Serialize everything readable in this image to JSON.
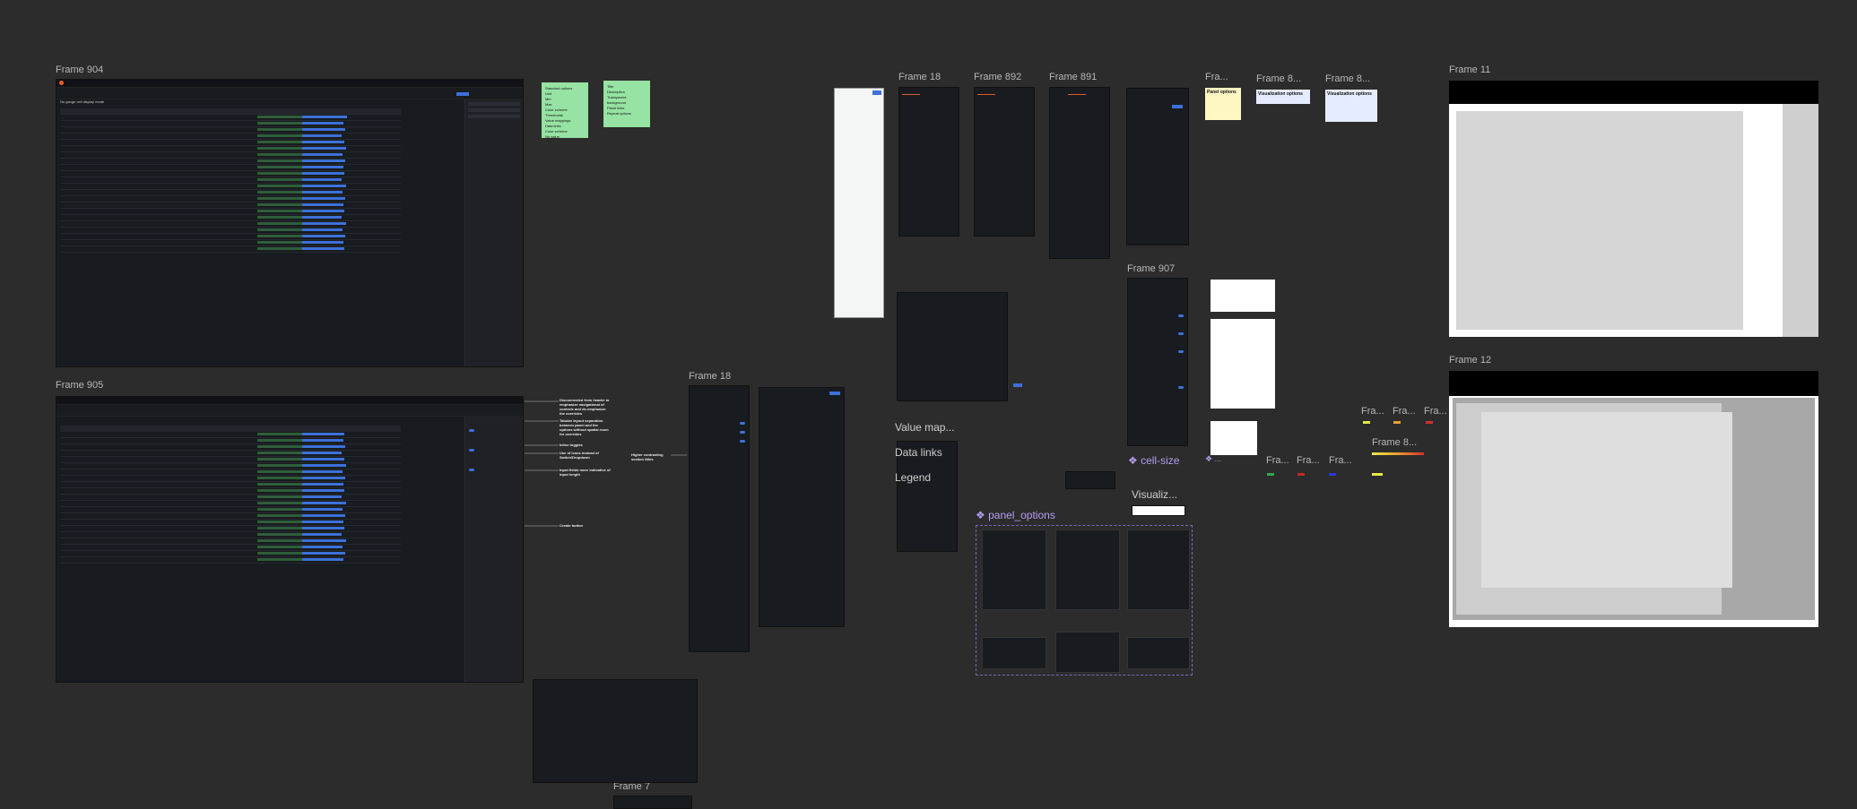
{
  "frames": {
    "f904": "Frame 904",
    "f905": "Frame 905",
    "f18a": "Frame 18",
    "f892": "Frame 892",
    "f891": "Frame 891",
    "fra1": "Fra...",
    "f8a": "Frame 8...",
    "f8b": "Frame 8...",
    "f11": "Frame 11",
    "f907": "Frame 907",
    "f12": "Frame 12",
    "f18b": "Frame 18",
    "f7": "Frame 7",
    "fra2": "Fra...",
    "fra3": "Fra...",
    "fra4": "Fra...",
    "fra5": "Fra...",
    "fra6": "Fra...",
    "f8c": "Frame 8..."
  },
  "components": {
    "value_map": "Value map...",
    "data_links": "Data links",
    "legend": "Legend",
    "panel_options": "panel_options",
    "cell_size": "cell-size",
    "visualiz": "Visualiz...",
    "dots": "..."
  },
  "notes": {
    "panel_options": "Panel options",
    "viz_options_a": "Visualization options",
    "viz_options_b": "Visualization options",
    "sticky_a": [
      "Standard options",
      "Unit",
      "Min",
      "Max",
      "Color scheme",
      "Thresholds",
      "Value mappings",
      "Data links",
      "Color scheme",
      "No value"
    ],
    "sticky_b": [
      "Title",
      "Description",
      "Transparent",
      "background",
      "Panel links",
      "Repeat options"
    ]
  },
  "annotations": [
    "Disconnected from header to emphasize navigational of controls and de-emphasize the overrides",
    "Tabular layout separation between panel and the options without spatial room for overrides",
    "Inline toggles",
    "Use of icons instead of Switch/Dropdown",
    "Input fields more indicative of input length",
    "Create button",
    "Higher contrasting section titles"
  ],
  "table": {
    "note": "No gauge cell display mode",
    "headers": [
      "Time",
      "Host",
      "Min",
      "Max",
      "Gauge",
      "Value"
    ]
  },
  "colors": {
    "accent": "#3d71d9",
    "sticky": "#96e3a3",
    "purple": "#b79cf0",
    "canvas": "#2c2c2c",
    "panel": "#181b1f"
  }
}
